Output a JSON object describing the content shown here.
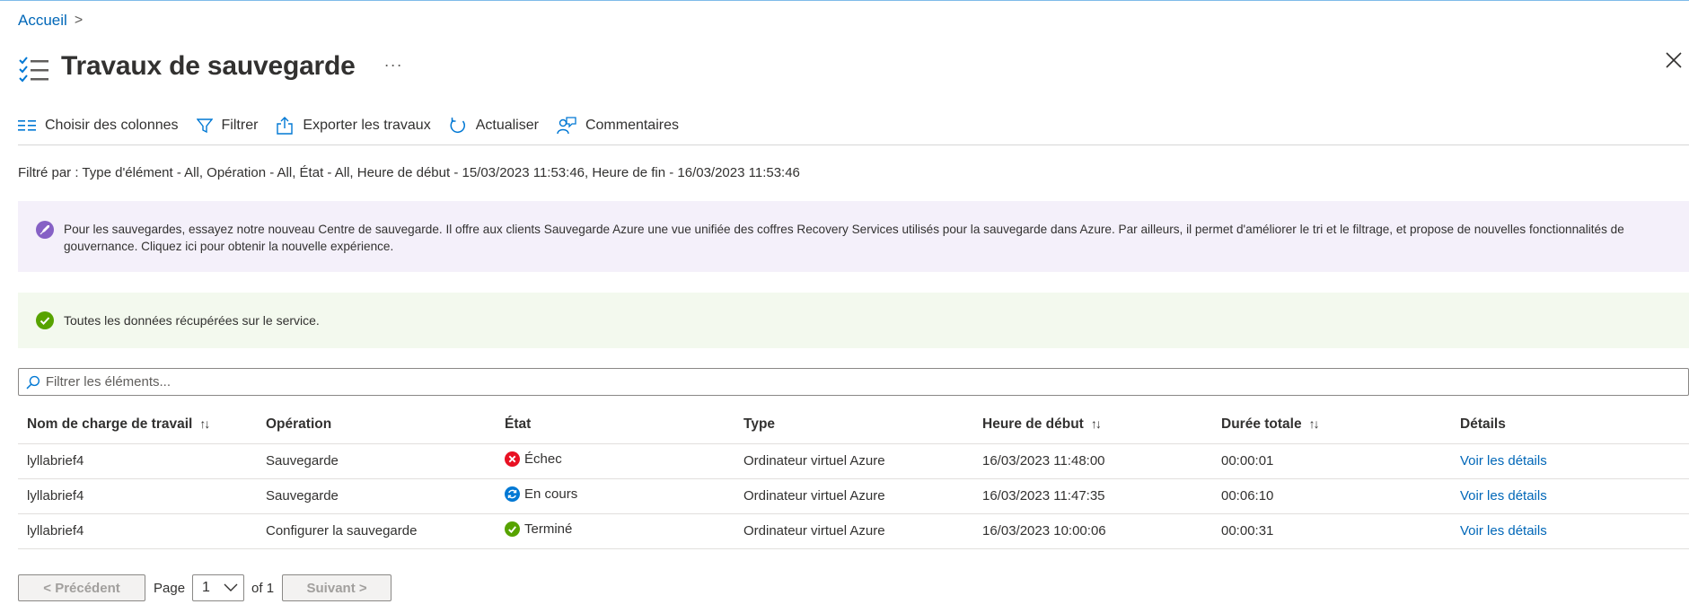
{
  "breadcrumb": {
    "home": "Accueil",
    "separator": ">"
  },
  "header": {
    "title": "Travaux de sauvegarde",
    "more": "···",
    "icon": "task-list-icon"
  },
  "toolbar": {
    "choose_columns": "Choisir des colonnes",
    "filter": "Filtrer",
    "export": "Exporter les travaux",
    "refresh": "Actualiser",
    "feedback": "Commentaires"
  },
  "filter_summary": "Filtré par : Type d'élément - All, Opération - All, État - All, Heure de début - 15/03/2023 11:53:46, Heure de fin - 16/03/2023 11:53:46",
  "banners": {
    "promo": "Pour les sauvegardes, essayez notre nouveau Centre de sauvegarde. Il offre aux clients Sauvegarde Azure une vue unifiée des coffres Recovery Services utilisés pour la sauvegarde dans Azure. Par ailleurs, il permet d'améliorer le tri et le filtrage, et propose de nouvelles fonctionnalités de gouvernance. Cliquez ici pour obtenir la nouvelle expérience.",
    "success": "Toutes les données récupérées sur le service."
  },
  "search": {
    "placeholder": "Filtrer les éléments..."
  },
  "table": {
    "headers": {
      "workload": "Nom de charge de travail",
      "operation": "Opération",
      "status": "État",
      "type": "Type",
      "start": "Heure de début",
      "duration": "Durée totale",
      "details": "Détails"
    },
    "rows": [
      {
        "workload": "lyllabrief4",
        "operation": "Sauvegarde",
        "status": "Échec",
        "status_icon": "error-icon",
        "type": "Ordinateur virtuel Azure",
        "start": "16/03/2023 11:48:00",
        "duration": "00:00:01",
        "details": "Voir les détails"
      },
      {
        "workload": "lyllabrief4",
        "operation": "Sauvegarde",
        "status": "En cours",
        "status_icon": "in-progress-icon",
        "type": "Ordinateur virtuel Azure",
        "start": "16/03/2023 11:47:35",
        "duration": "00:06:10",
        "details": "Voir les détails"
      },
      {
        "workload": "lyllabrief4",
        "operation": "Configurer la sauvegarde",
        "status": "Terminé",
        "status_icon": "success-icon",
        "type": "Ordinateur virtuel Azure",
        "start": "16/03/2023 10:00:06",
        "duration": "00:00:31",
        "details": "Voir les détails"
      }
    ]
  },
  "pagination": {
    "prev": "< Précédent",
    "page_label": "Page",
    "current": "1",
    "of": "of 1",
    "next": "Suivant >"
  },
  "colors": {
    "accent": "#0078d4",
    "link": "#0067b8",
    "error": "#e81123",
    "success": "#57a300",
    "progress": "#0078d4",
    "purple_banner": "#f4f0fa",
    "green_banner": "#f3f9ee"
  }
}
